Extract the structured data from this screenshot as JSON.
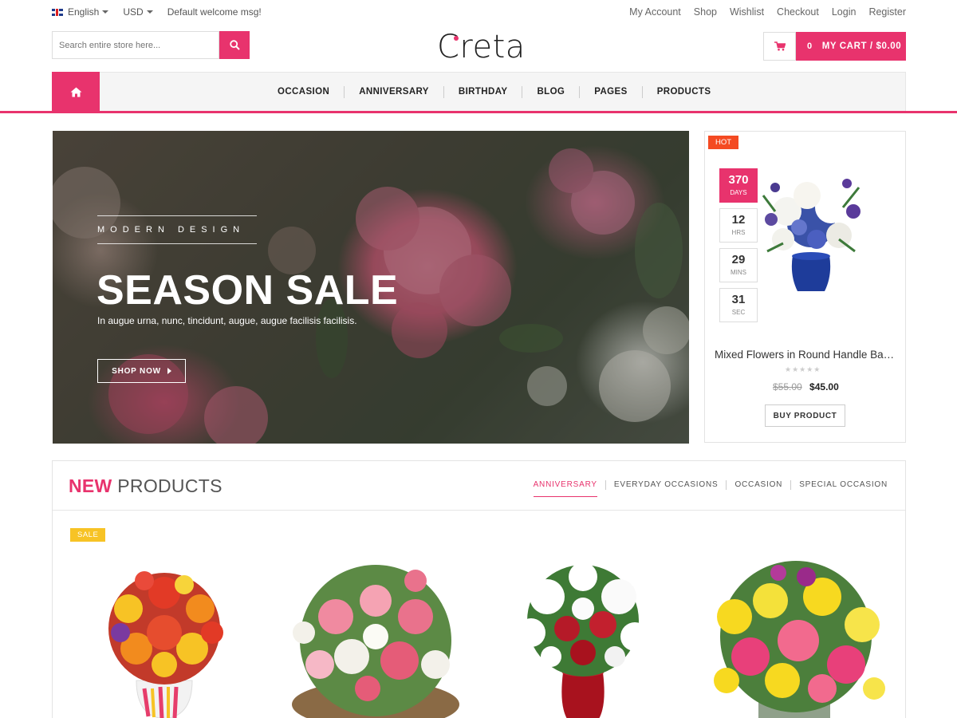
{
  "topbar": {
    "language": "English",
    "currency": "USD",
    "welcome": "Default welcome msg!",
    "links": [
      "My Account",
      "Shop",
      "Wishlist",
      "Checkout",
      "Login",
      "Register"
    ]
  },
  "header": {
    "search_placeholder": "Search entire store here...",
    "logo": "Creta",
    "cart_count": "0",
    "cart_label": "MY CART / $0.00"
  },
  "nav": {
    "items": [
      "OCCASION",
      "ANNIVERSARY",
      "BIRTHDAY",
      "BLOG",
      "PAGES",
      "PRODUCTS"
    ]
  },
  "hero": {
    "subtitle": "MODERN DESIGN",
    "title": "SEASON SALE",
    "text": "In augue urna, nunc, tincidunt, augue, augue facilisis facilisis.",
    "button": "SHOP NOW"
  },
  "hot_deal": {
    "badge": "HOT",
    "countdown": [
      {
        "value": "370",
        "unit": "DAYS"
      },
      {
        "value": "12",
        "unit": "HRS"
      },
      {
        "value": "29",
        "unit": "MINS"
      },
      {
        "value": "31",
        "unit": "SEC"
      }
    ],
    "product_name": "Mixed Flowers in Round Handle Bas...",
    "old_price": "$55.00",
    "new_price": "$45.00",
    "button": "BUY PRODUCT"
  },
  "new_products": {
    "title_highlight": "NEW",
    "title_rest": "PRODUCTS",
    "tabs": [
      "ANNIVERSARY",
      "EVERYDAY OCCASIONS",
      "OCCASION",
      "SPECIAL OCCASION"
    ],
    "active_tab": "ANNIVERSARY",
    "sale_badge": "SALE"
  },
  "colors": {
    "accent": "#e8336d",
    "hot": "#f44a22",
    "sale": "#f7c325"
  },
  "icons": [
    "flag-uk-icon",
    "search-icon",
    "cart-icon",
    "home-icon",
    "arrow-right-icon"
  ]
}
